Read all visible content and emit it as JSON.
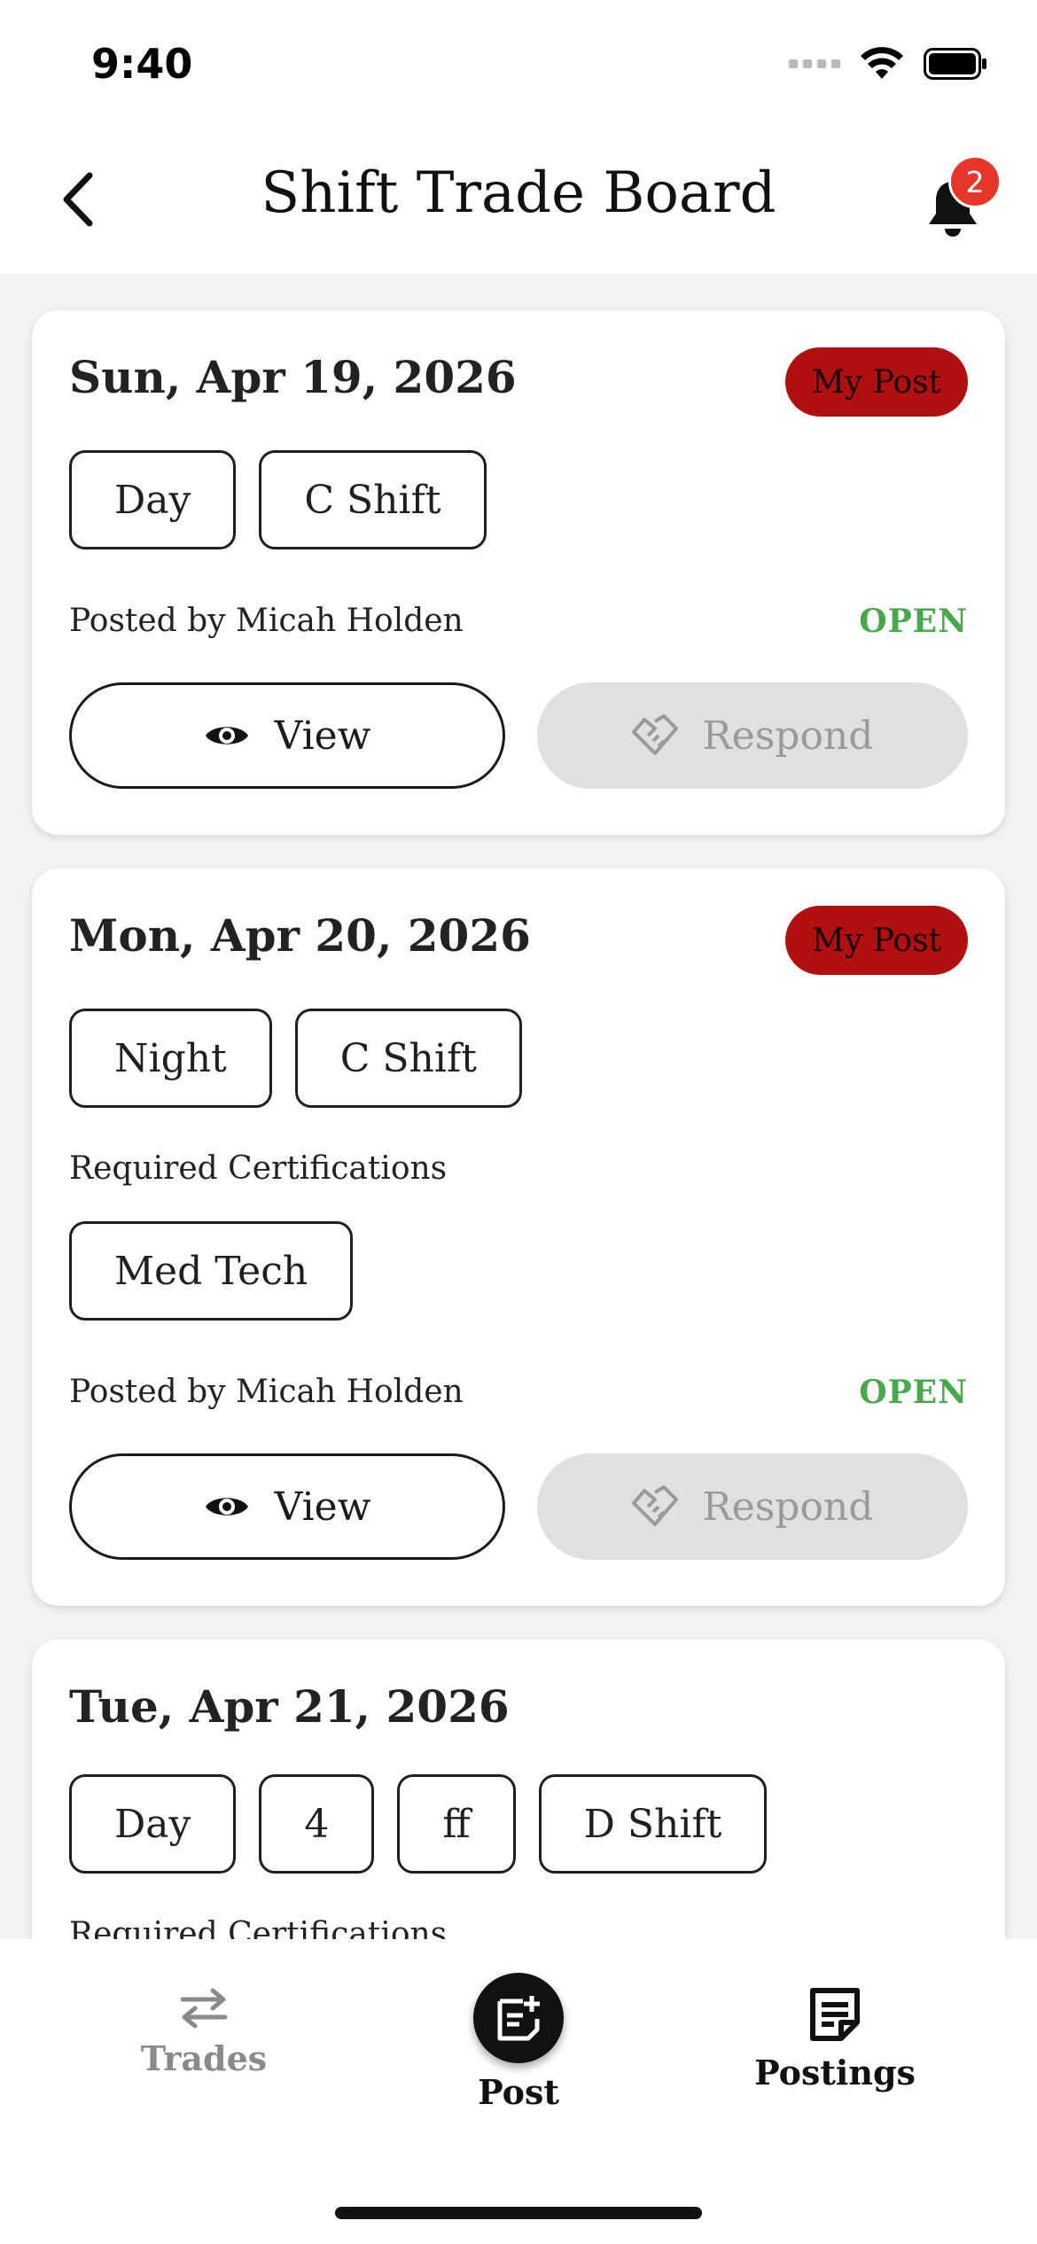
{
  "status_bar": {
    "time": "9:40"
  },
  "header": {
    "title": "Shift Trade Board",
    "notification_count": "2"
  },
  "cards": [
    {
      "date": "Sun, Apr 19, 2026",
      "badge": "My Post",
      "chips": [
        "Day",
        "C Shift"
      ],
      "posted_by": "Posted by Micah Holden",
      "status": "OPEN",
      "view_label": "View",
      "respond_label": "Respond"
    },
    {
      "date": "Mon, Apr 20, 2026",
      "badge": "My Post",
      "chips": [
        "Night",
        "C Shift"
      ],
      "certifications_label": "Required Certifications",
      "certifications": [
        "Med Tech"
      ],
      "posted_by": "Posted by Micah Holden",
      "status": "OPEN",
      "view_label": "View",
      "respond_label": "Respond"
    },
    {
      "date": "Tue, Apr 21, 2026",
      "chips": [
        "Day",
        "4",
        "ff",
        "D Shift"
      ],
      "certifications_label": "Required Certifications"
    }
  ],
  "tabbar": {
    "trades_label": "Trades",
    "post_label": "Post",
    "postings_label": "Postings"
  },
  "colors": {
    "my_post_badge": "#b0100f",
    "open_status": "#48a94a",
    "notification_badge": "#e6362b",
    "respond_disabled": "#e0e0e0"
  },
  "icons": [
    "back-chevron-icon",
    "bell-icon",
    "eye-icon",
    "handshake-icon",
    "swap-arrows-icon",
    "add-note-icon",
    "postings-icon"
  ]
}
